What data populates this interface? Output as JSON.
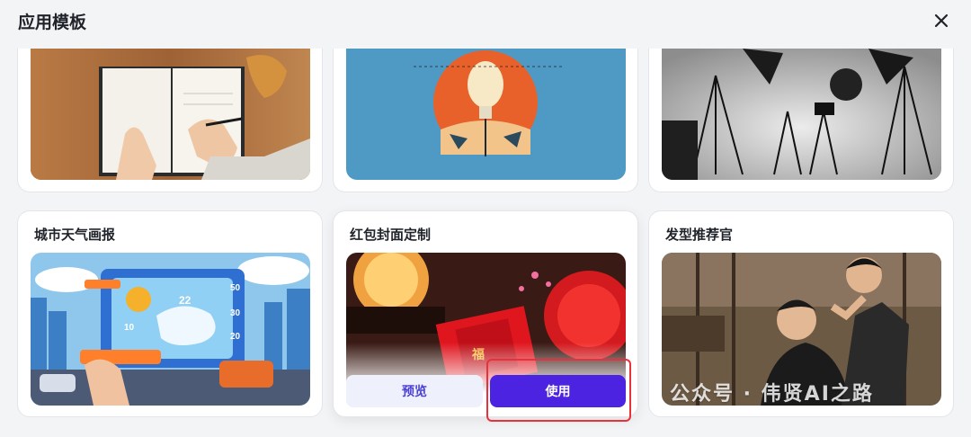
{
  "header": {
    "title": "应用模板"
  },
  "cards_top": [
    {
      "name": "notebook-writing"
    },
    {
      "name": "lightbulb-illustration"
    },
    {
      "name": "photo-studio"
    }
  ],
  "cards_bottom": [
    {
      "label": "城市天气画报"
    },
    {
      "label": "红包封面定制",
      "preview_label": "预览",
      "use_label": "使用"
    },
    {
      "label": "发型推荐官"
    }
  ],
  "weather_poster": {
    "temp_main": "22",
    "temp_low": "10",
    "side_a": "50",
    "side_b": "30",
    "side_c": "20"
  },
  "red_envelope": {
    "char": "福"
  },
  "watermark": "公众号 · 伟贤AI之路",
  "colors": {
    "accent": "#4b23e0",
    "highlight": "#e8313b",
    "preview_bg": "#eef0fb"
  }
}
